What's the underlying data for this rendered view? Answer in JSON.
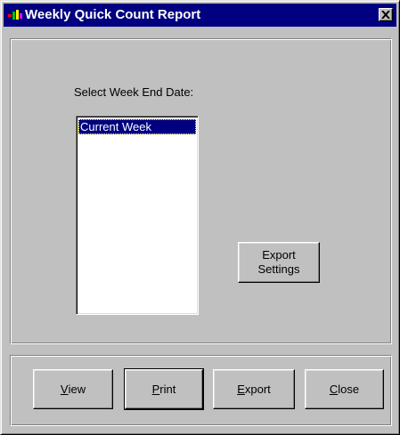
{
  "window": {
    "title": "Weekly Quick Count Report",
    "colors": {
      "titlebar": "#000080",
      "face": "#c0c0c0",
      "selection": "#000080"
    }
  },
  "icons": {
    "app": "app-logo-icon",
    "close": "close-icon"
  },
  "week_selector": {
    "label": "Select Week End Date:",
    "items": [
      "Current Week"
    ],
    "selected_index": 0
  },
  "buttons": {
    "export_settings_line1": "Export",
    "export_settings_line2": "Settings",
    "view": {
      "mnemonic": "V",
      "rest": "iew"
    },
    "print": {
      "mnemonic": "P",
      "rest": "rint"
    },
    "export": {
      "mnemonic": "E",
      "rest": "xport"
    },
    "close": {
      "mnemonic": "C",
      "rest": "lose"
    }
  }
}
